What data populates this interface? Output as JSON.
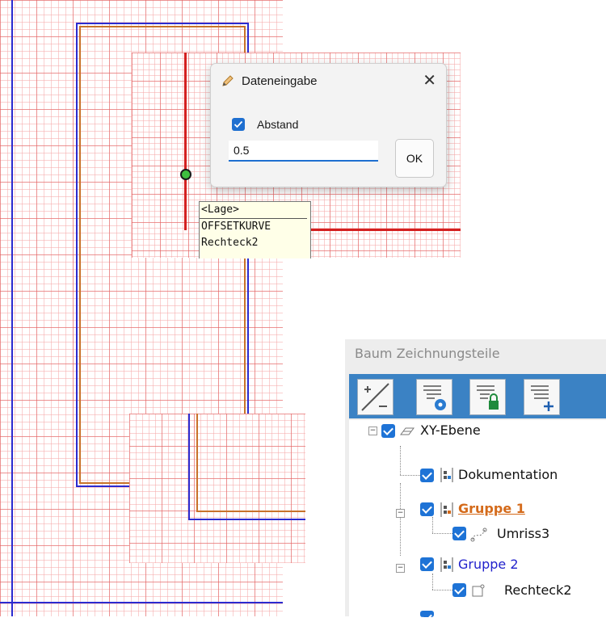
{
  "dialog": {
    "title": "Dateneingabe",
    "close_glyph": "✕",
    "checkbox_label": "Abstand",
    "checkbox_checked": true,
    "value": "0.5",
    "ok_label": "OK",
    "icon": "pencil-icon"
  },
  "tooltip": {
    "header": "<Lage>",
    "line1": "OFFSETKURVE",
    "line2": "Rechteck2"
  },
  "tree": {
    "title": "Baum Zeichnungsteile",
    "toolbar_icons": [
      "add-remove-icon",
      "visibility-icon",
      "lock-icon",
      "add-layer-icon"
    ],
    "nodes": [
      {
        "label": "XY-Ebene",
        "icon": "plane-icon",
        "checked": true
      },
      {
        "label": "Dokumentation",
        "icon": "group-icon",
        "checked": true
      },
      {
        "label": "Gruppe 1",
        "icon": "group-icon",
        "checked": true,
        "color": "#d46a1a"
      },
      {
        "label": "Umriss3",
        "icon": "curve-icon",
        "checked": true
      },
      {
        "label": "Gruppe 2",
        "icon": "group-icon",
        "checked": true,
        "color": "#2222cc"
      },
      {
        "label": "Rechteck2",
        "icon": "rectangle-icon",
        "checked": true
      }
    ]
  },
  "colors": {
    "outline_blue": "#2b2bd0",
    "offset_orange": "#c8732a",
    "selection_red": "#d42020",
    "toolbar_blue": "#3b82c4"
  }
}
